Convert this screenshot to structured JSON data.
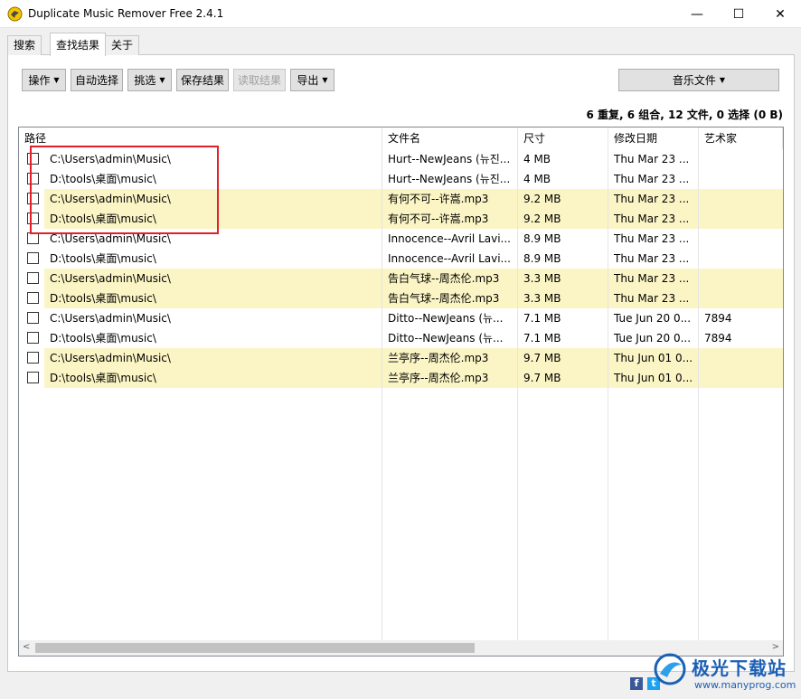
{
  "window": {
    "title": "Duplicate Music Remover Free 2.4.1",
    "minimize_glyph": "—",
    "maximize_glyph": "☐",
    "close_glyph": "✕",
    "icon": "dove-icon"
  },
  "tabs": [
    {
      "label": "搜索"
    },
    {
      "label": "查找结果"
    },
    {
      "label": "关于"
    }
  ],
  "toolbar": {
    "operate": "操作",
    "auto_select": "自动选择",
    "pick": "挑选",
    "save_results": "保存结果",
    "load_results": "读取结果",
    "export": "导出",
    "music_files": "音乐文件"
  },
  "summary": "6 重复, 6 组合, 12 文件, 0 选择 (0 B)",
  "columns": {
    "path": "路径",
    "filename": "文件名",
    "size": "尺寸",
    "modified": "修改日期",
    "artist": "艺术家"
  },
  "rows": [
    {
      "path": "C:\\Users\\admin\\Music\\",
      "filename": "Hurt--NewJeans (뉴진...",
      "size": "4 MB",
      "modified": "Thu Mar 23 ...",
      "artist": "",
      "highlight": false
    },
    {
      "path": "D:\\tools\\桌面\\music\\",
      "filename": "Hurt--NewJeans (뉴진...",
      "size": "4 MB",
      "modified": "Thu Mar 23 ...",
      "artist": "",
      "highlight": false
    },
    {
      "path": "C:\\Users\\admin\\Music\\",
      "filename": "有何不可--许嵩.mp3",
      "size": "9.2 MB",
      "modified": "Thu Mar 23 ...",
      "artist": "",
      "highlight": true
    },
    {
      "path": "D:\\tools\\桌面\\music\\",
      "filename": "有何不可--许嵩.mp3",
      "size": "9.2 MB",
      "modified": "Thu Mar 23 ...",
      "artist": "",
      "highlight": true
    },
    {
      "path": "C:\\Users\\admin\\Music\\",
      "filename": "Innocence--Avril Lavi...",
      "size": "8.9 MB",
      "modified": "Thu Mar 23 ...",
      "artist": "",
      "highlight": false
    },
    {
      "path": "D:\\tools\\桌面\\music\\",
      "filename": "Innocence--Avril Lavi...",
      "size": "8.9 MB",
      "modified": "Thu Mar 23 ...",
      "artist": "",
      "highlight": false
    },
    {
      "path": "C:\\Users\\admin\\Music\\",
      "filename": "告白气球--周杰伦.mp3",
      "size": "3.3 MB",
      "modified": "Thu Mar 23 ...",
      "artist": "",
      "highlight": true
    },
    {
      "path": "D:\\tools\\桌面\\music\\",
      "filename": "告白气球--周杰伦.mp3",
      "size": "3.3 MB",
      "modified": "Thu Mar 23 ...",
      "artist": "",
      "highlight": true
    },
    {
      "path": "C:\\Users\\admin\\Music\\",
      "filename": "Ditto--NewJeans (뉴...",
      "size": "7.1 MB",
      "modified": "Tue Jun 20 0...",
      "artist": "7894",
      "highlight": false
    },
    {
      "path": "D:\\tools\\桌面\\music\\",
      "filename": "Ditto--NewJeans (뉴...",
      "size": "7.1 MB",
      "modified": "Tue Jun 20 0...",
      "artist": "7894",
      "highlight": false
    },
    {
      "path": "C:\\Users\\admin\\Music\\",
      "filename": "兰亭序--周杰伦.mp3",
      "size": "9.7 MB",
      "modified": "Thu Jun 01 0...",
      "artist": "",
      "highlight": true
    },
    {
      "path": "D:\\tools\\桌面\\music\\",
      "filename": "兰亭序--周杰伦.mp3",
      "size": "9.7 MB",
      "modified": "Thu Jun 01 0...",
      "artist": "",
      "highlight": true
    }
  ],
  "scrollbar": {
    "left_glyph": "<",
    "right_glyph": ">"
  },
  "watermark": {
    "brand": "极光下载站",
    "url": "www.manyprog.com",
    "facebook": "f",
    "twitter": "t"
  },
  "colors": {
    "highlight_row": "#fbf5c5",
    "annotation": "#e0202a",
    "watermark": "#1c5fb5"
  }
}
